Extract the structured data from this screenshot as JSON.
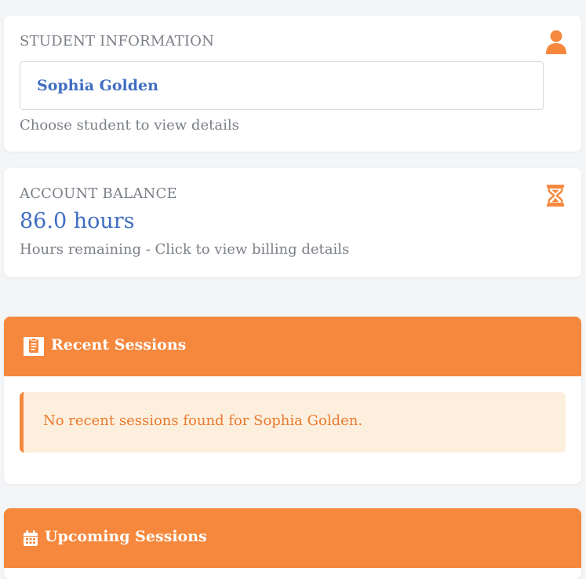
{
  "student": {
    "title": "STUDENT INFORMATION",
    "selected": "Sophia Golden",
    "help": "Choose student to view details",
    "icon": "user-icon"
  },
  "balance": {
    "title": "ACCOUNT BALANCE",
    "value": "86.0 hours",
    "help": "Hours remaining - Click to view billing details",
    "icon": "hourglass-icon"
  },
  "recent": {
    "title": "Recent Sessions",
    "icon": "clipboard-icon",
    "empty_message": "No recent sessions found for Sophia Golden."
  },
  "upcoming": {
    "title": "Upcoming Sessions",
    "icon": "calendar-icon"
  },
  "colors": {
    "accent": "#f5883d",
    "link": "#3f6ec2",
    "alert_bg": "#fdefdd"
  }
}
